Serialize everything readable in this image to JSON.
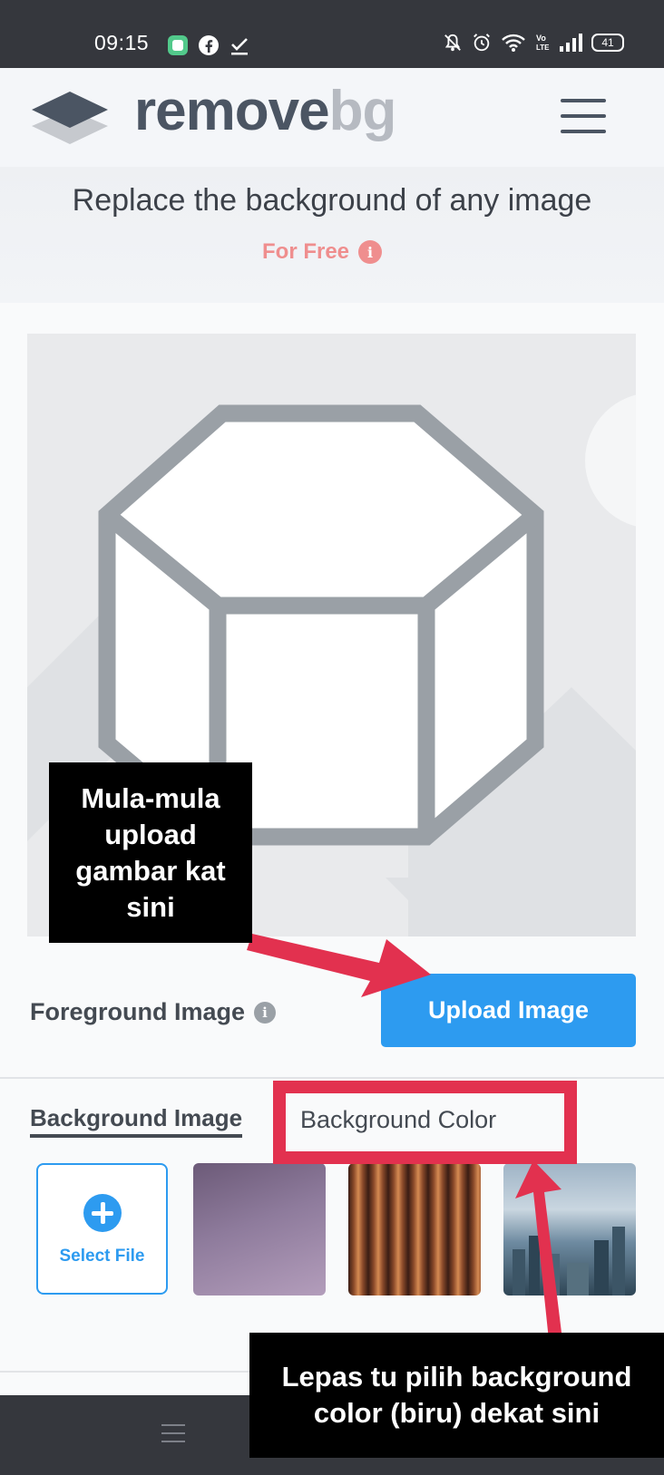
{
  "status_bar": {
    "time": "09:15",
    "left_icons": [
      "chat-app-icon",
      "facebook-icon",
      "download-done-icon"
    ],
    "right_icons": [
      "bell-off-icon",
      "alarm-icon",
      "wifi-icon",
      "volte-icon",
      "signal-icon"
    ],
    "battery": "41"
  },
  "header": {
    "logo_remove": "remove",
    "logo_bg": "bg",
    "menu_icon": "hamburger-menu-icon"
  },
  "hero": {
    "title": "Replace the background of any image",
    "free_label": "For Free",
    "info_glyph": "i"
  },
  "foreground": {
    "label": "Foreground Image",
    "info_glyph": "i",
    "upload_button": "Upload Image"
  },
  "background": {
    "tabs": [
      {
        "label": "Background Image",
        "active": true
      },
      {
        "label": "Background Color",
        "active": false
      }
    ],
    "select_file_label": "Select File",
    "thumbnails": [
      "purple-gradient",
      "copper-stripes",
      "city-skyline"
    ]
  },
  "annotations": {
    "note1": "Mula-mula upload gambar kat sini",
    "note2": "Lepas tu pilih background color (biru) dekat sini"
  },
  "colors": {
    "accent": "#2d9bf0",
    "annotation_red": "#e2314f",
    "free_pink": "#ef8e8e",
    "dark": "#35373d"
  }
}
